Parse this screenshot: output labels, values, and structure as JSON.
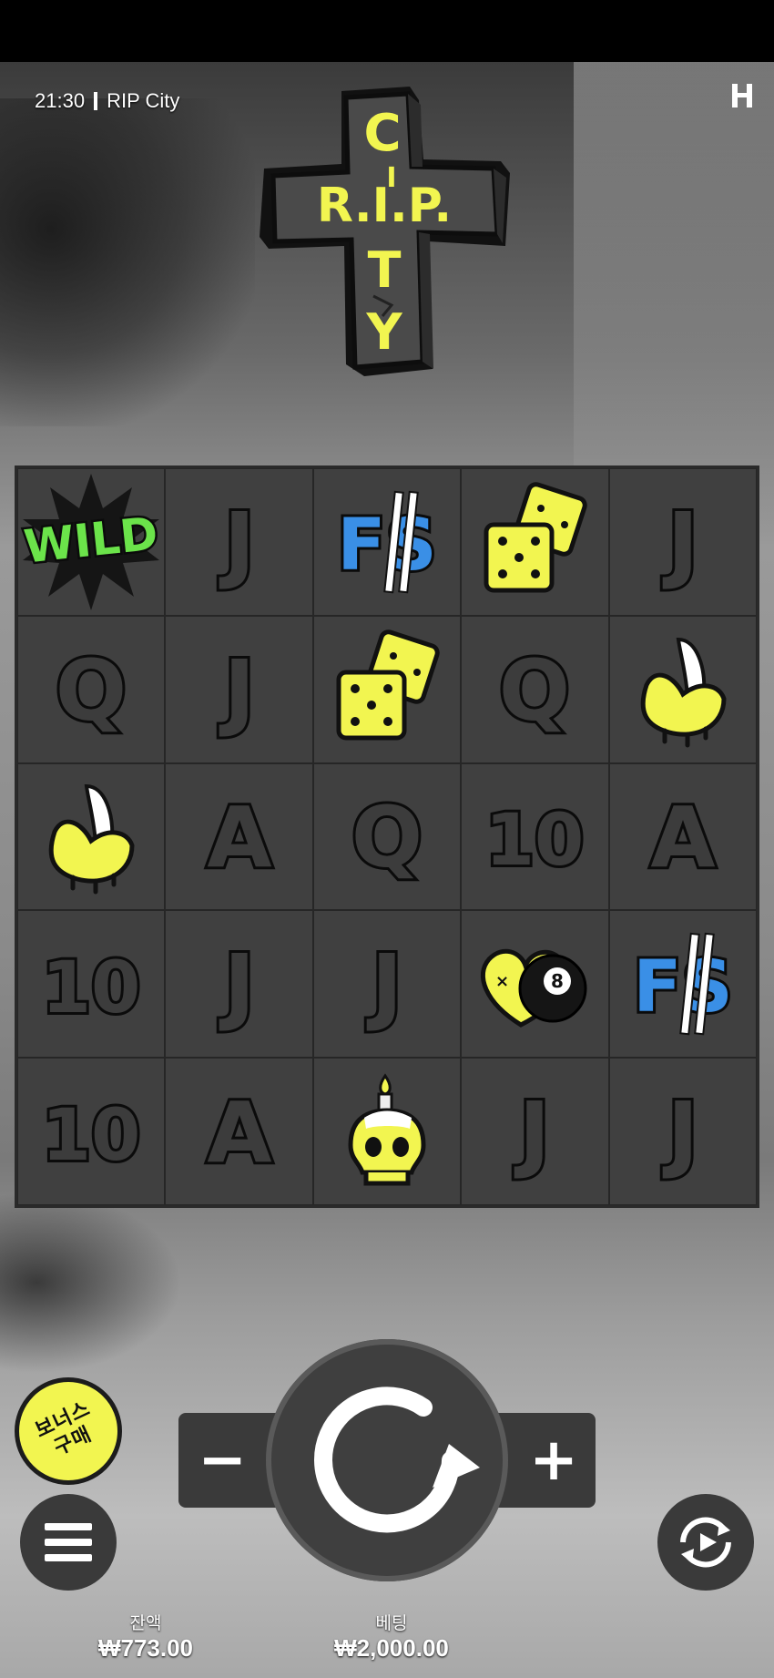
{
  "header": {
    "time": "21:30",
    "game_title": "RIP City"
  },
  "logo": {
    "top_text": "C",
    "cross_text": "R.I.P.",
    "vertical_text": "TY",
    "vertical_i": "I"
  },
  "grid": {
    "rows": [
      [
        "WILD",
        "J",
        "FS",
        "dice",
        "J"
      ],
      [
        "Q",
        "J",
        "dice",
        "Q",
        "banana"
      ],
      [
        "banana",
        "A",
        "Q",
        "10",
        "A"
      ],
      [
        "10",
        "J",
        "J",
        "heart-8ball",
        "FS"
      ],
      [
        "10",
        "A",
        "skull-candle",
        "J",
        "J"
      ]
    ]
  },
  "controls": {
    "bonus_buy_label": "보너스 구매",
    "minus_label": "−",
    "plus_label": "+"
  },
  "footer": {
    "balance_label": "잔액",
    "balance_value": "₩773.00",
    "bet_label": "베팅",
    "bet_value": "₩2,000.00"
  },
  "colors": {
    "accent_yellow": "#f2f550",
    "wild_green": "#6be34a",
    "fs_blue": "#3a8fe6"
  }
}
